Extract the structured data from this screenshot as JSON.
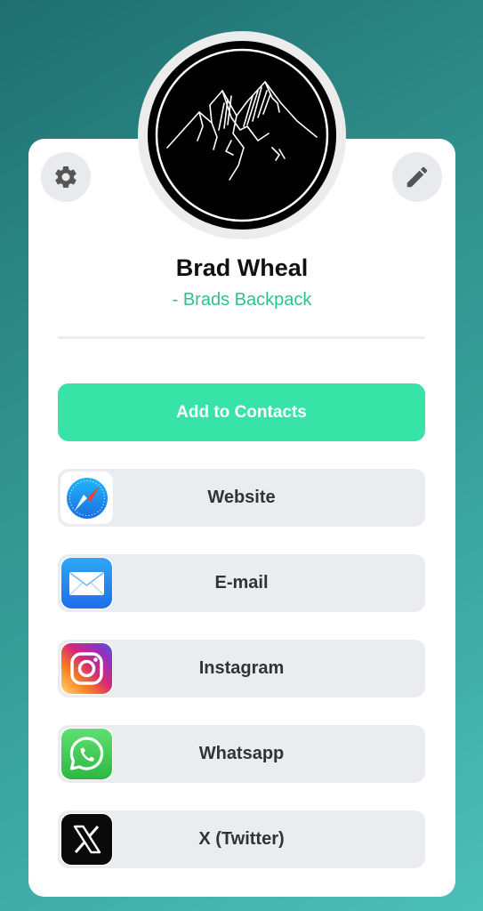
{
  "profile": {
    "name": "Brad Wheal",
    "subtitle": "- Brads Backpack"
  },
  "actions": {
    "add_contacts_label": "Add to Contacts"
  },
  "links": [
    {
      "label": "Website",
      "icon": "safari-compass-icon"
    },
    {
      "label": "E-mail",
      "icon": "mail-envelope-icon"
    },
    {
      "label": "Instagram",
      "icon": "instagram-icon"
    },
    {
      "label": "Whatsapp",
      "icon": "whatsapp-icon"
    },
    {
      "label": "X (Twitter)",
      "icon": "x-twitter-icon"
    }
  ],
  "toolbar": {
    "settings_icon": "gear-icon",
    "edit_icon": "pencil-icon"
  },
  "colors": {
    "accent_green": "#37e3a6",
    "subtitle_teal": "#2fbf95",
    "background_teal": "#2f8f8b"
  }
}
